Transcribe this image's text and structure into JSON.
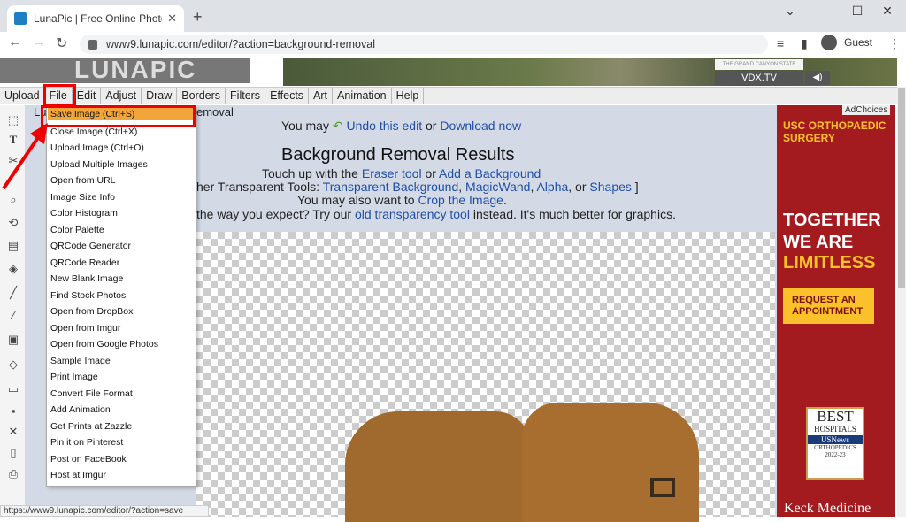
{
  "browser": {
    "tab_title": "LunaPic | Free Online Photo Ed",
    "tab_close": "✕",
    "new_tab": "+",
    "url": "www9.lunapic.com/editor/?action=background-removal",
    "profile": "Guest",
    "window_buttons": [
      "⌄",
      "—",
      "☐",
      "✕"
    ],
    "status_url": "https://www9.lunapic.com/editor/?action=save"
  },
  "site": {
    "logo": "LUNAPIC",
    "ad_brand": "VDX.TV",
    "ad_brand_sub": "THE GRAND CANYON STATE",
    "ad_sound": "◀)"
  },
  "menu": [
    "Upload",
    "File",
    "Edit",
    "Adjust",
    "Draw",
    "Borders",
    "Filters",
    "Effects",
    "Art",
    "Animation",
    "Help"
  ],
  "breadcrumb_start": "Lu",
  "breadcrumb_end": "emoval",
  "content": {
    "undo_prefix": "You may",
    "undo_link": "Undo this edit",
    "or": "or",
    "download_link": "Download now",
    "title": "Background Removal Results",
    "touch_prefix": "Touch up with the",
    "eraser_link": "Eraser tool",
    "add_bg_link": "Add a Background",
    "tools_prefix": "her Transparent Tools:",
    "transparent_link": "Transparent Background",
    "magicwand_link": "MagicWand",
    "alpha_link": "Alpha",
    "or2": ", or",
    "shapes_link": "Shapes",
    "close_bracket": "]",
    "crop_prefix": "You may also want to",
    "crop_link": "Crop the Image",
    "old_prefix": "the way you expect? Try our",
    "old_link": "old transparency tool",
    "old_suffix": "instead. It's much better for graphics."
  },
  "file_menu": [
    "Save Image (Ctrl+S)",
    "Close Image (Ctrl+X)",
    "Upload Image (Ctrl+O)",
    "Upload Multiple Images",
    "Open from URL",
    "Image Size Info",
    "Color Histogram",
    "Color Palette",
    "QRCode Generator",
    "QRCode Reader",
    "New Blank Image",
    "Find Stock Photos",
    "Open from DropBox",
    "Open from Imgur",
    "Open from Google Photos",
    "Sample Image",
    "Print Image",
    "Convert File Format",
    "Add Animation",
    "Get Prints at Zazzle",
    "Pin it on Pinterest",
    "Post on FaceBook",
    "Host at Imgur"
  ],
  "ad": {
    "adchoices": "AdChoices",
    "headline": "USC ORTHOPAEDIC SURGERY",
    "line1": "TOGETHER",
    "line2": "WE ARE",
    "line3": "LIMITLESS",
    "button": "REQUEST AN APPOINTMENT",
    "badge_best": "BEST",
    "badge_hosp": "HOSPITALS",
    "badge_usn": "USNews",
    "badge_spec": "ORTHOPEDICS",
    "badge_year": "2022-23",
    "footer": "Keck Medicine"
  },
  "colors": {
    "highlight": "#e00000",
    "selected_item": "#f2a53a",
    "ad_bg": "#a31b1f",
    "ad_accent": "#fbc12b",
    "link": "#1f4fa8",
    "content_bg": "#d3dae6"
  }
}
